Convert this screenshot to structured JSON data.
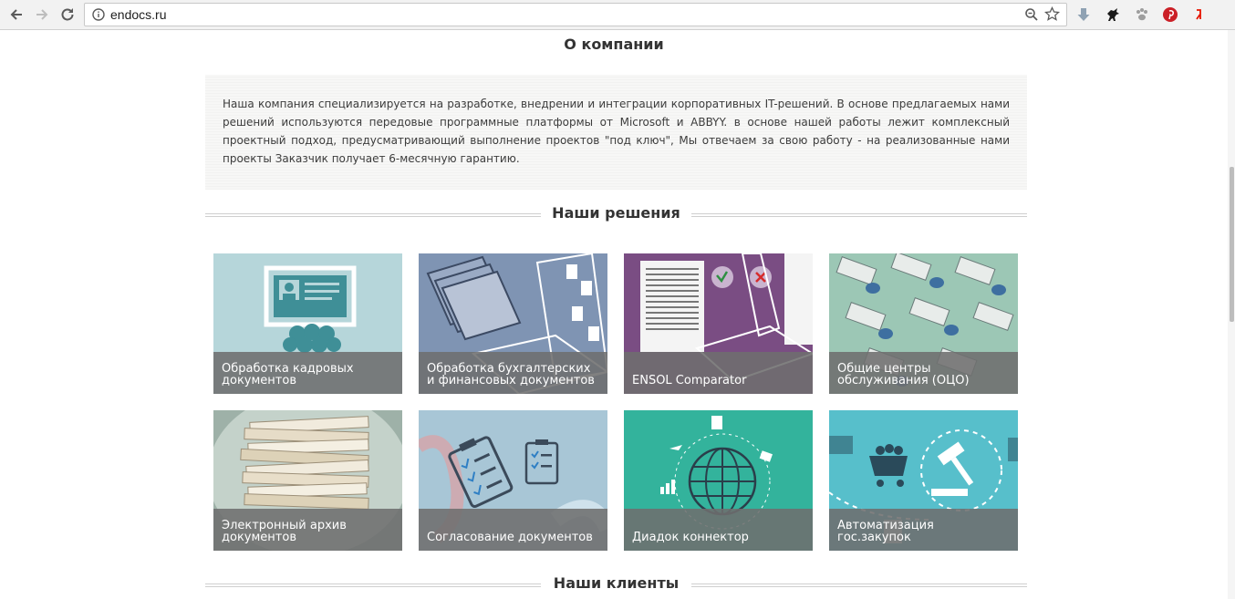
{
  "browser": {
    "url": "endocs.ru",
    "icons": {
      "back": "arrow-left-icon",
      "forward": "arrow-right-icon",
      "reload": "reload-icon",
      "info": "info-icon",
      "zoom": "zoom-icon",
      "bookmark": "star-icon"
    },
    "extensions": [
      "download-arrow-icon",
      "horse-icon",
      "paw-icon",
      "pinterest-icon",
      "yandex-icon"
    ]
  },
  "about": {
    "title": "О компании",
    "text": "Наша компания специализируется на разработке, внедрении и интеграции корпоративных IT-решений. В основе предлагаемых нами решений используются передовые программные платформы от Microsoft и ABBYY. в основе нашей работы лежит комплексный проектный подход, предусматривающий выполнение проектов \"под ключ\", Мы отвечаем за свою работу - на реализованные нами проекты Заказчик получает 6-месячную гарантию."
  },
  "solutions": {
    "title": "Наши решения",
    "items": [
      {
        "label": "Обработка кадровых документов",
        "bg": "#b6d6da"
      },
      {
        "label": "Обработка бухгалтерских и финансовых документов",
        "bg": "#7f94b3"
      },
      {
        "label": "ENSOL Comparator",
        "bg": "#7a4d83"
      },
      {
        "label": "Общие центры обслуживания (ОЦО)",
        "bg": "#9cc7b5"
      },
      {
        "label": "Электронный архив документов",
        "bg": "#9eb1a8"
      },
      {
        "label": "Согласование документов",
        "bg": "#a8c6d6"
      },
      {
        "label": "Диадок коннектор",
        "bg": "#33b39c"
      },
      {
        "label": "Автоматизация гос.закупок",
        "bg": "#57bfcb"
      }
    ]
  },
  "clients": {
    "title": "Наши клиенты"
  },
  "colors": {
    "heading": "#333333",
    "caption_overlay": "#6e6e6e",
    "pinterest": "#cb2027",
    "yandex": "#e61400"
  }
}
